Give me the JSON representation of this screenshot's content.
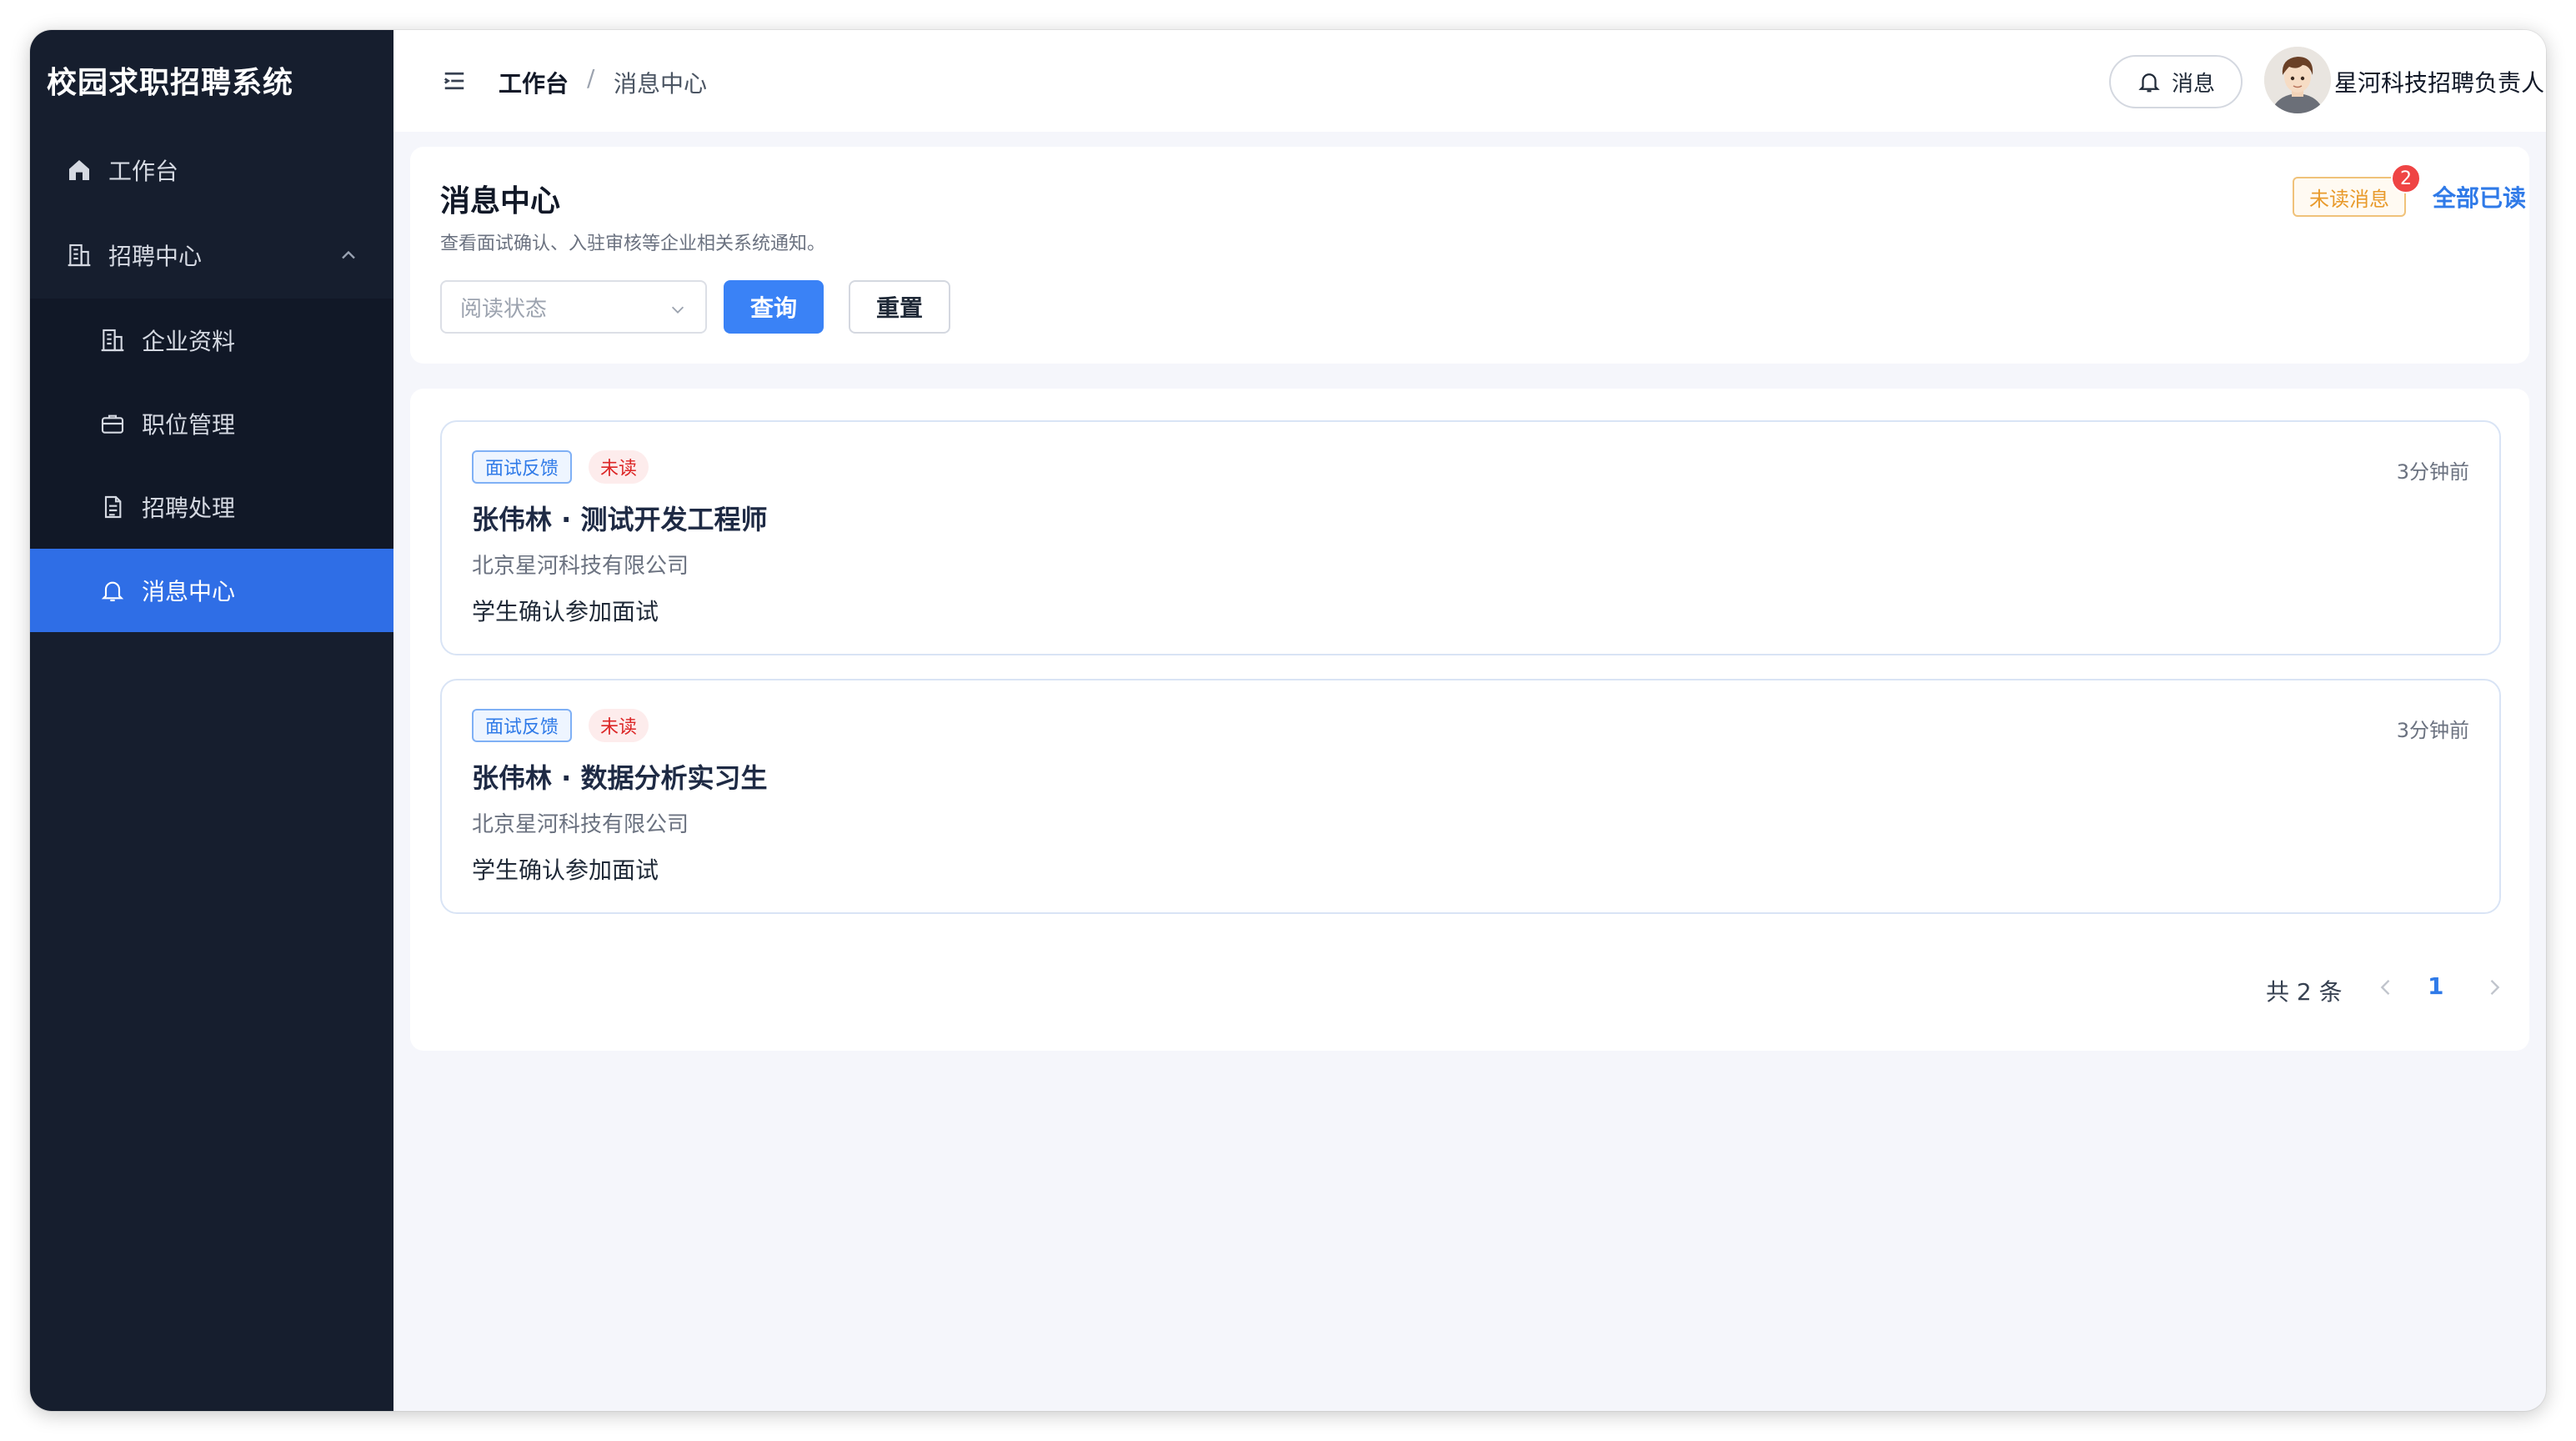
{
  "app": {
    "title": "校园求职招聘系统"
  },
  "sidebar": {
    "items": [
      {
        "label": "工作台",
        "icon": "home-icon"
      },
      {
        "label": "招聘中心",
        "icon": "building-icon",
        "expanded": true
      },
      {
        "label": "企业资料",
        "icon": "building-icon"
      },
      {
        "label": "职位管理",
        "icon": "briefcase-icon"
      },
      {
        "label": "招聘处理",
        "icon": "document-icon"
      },
      {
        "label": "消息中心",
        "icon": "bell-icon",
        "active": true
      }
    ]
  },
  "header": {
    "breadcrumb": [
      "工作台",
      "消息中心"
    ],
    "breadcrumb_sep": "/",
    "message_button": "消息",
    "user_name": "星河科技招聘负责人"
  },
  "filter": {
    "title": "消息中心",
    "description": "查看面试确认、入驻审核等企业相关系统通知。",
    "unread_tag": "未读消息",
    "unread_count": "2",
    "mark_all_read": "全部已读",
    "read_status_placeholder": "阅读状态",
    "query_button": "查询",
    "reset_button": "重置"
  },
  "messages": [
    {
      "type": "面试反馈",
      "status": "未读",
      "time": "3分钟前",
      "title": "张伟林 · 测试开发工程师",
      "company": "北京星河科技有限公司",
      "content": "学生确认参加面试"
    },
    {
      "type": "面试反馈",
      "status": "未读",
      "time": "3分钟前",
      "title": "张伟林 · 数据分析实习生",
      "company": "北京星河科技有限公司",
      "content": "学生确认参加面试"
    }
  ],
  "pagination": {
    "total_text": "共 2 条",
    "current_page": "1"
  },
  "colors": {
    "sidebar_bg": "#161e2e",
    "accent": "#2f6ee6",
    "unread_red": "#ef4444",
    "warning_orange": "#e89a2b"
  }
}
